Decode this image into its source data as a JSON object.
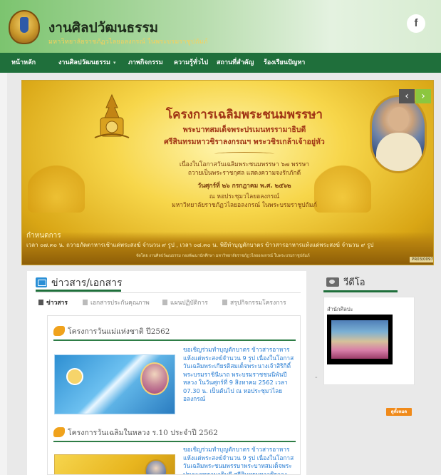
{
  "site": {
    "title": "งานศิลปวัฒนธรรม",
    "subtitle": "มหาวิทยาลัยราชภัฏวไลยอลงกรณ์ ในพระบรมราชูปถัมภ์",
    "social_icon": "facebook-icon",
    "social_glyph": "f"
  },
  "nav": {
    "items": [
      {
        "label": "หน้าหลัก"
      },
      {
        "label": "งานศิลปวัฒนธรรม",
        "caret": "▾"
      },
      {
        "label": "ภาพกิจกรรม"
      },
      {
        "label": "ความรู้ทั่วไป"
      },
      {
        "label": "สถานที่สำคัญ"
      },
      {
        "label": "ร้องเรียนปัญหา"
      }
    ]
  },
  "banner": {
    "title": "โครงการเฉลิมพระชนมพรรษา",
    "line1": "พระบาทสมเด็จพระปรเมนทรรามาธิบดี",
    "line2": "ศรีสินทรมหาวชิราลงกรณฯ พระวชิรเกล้าเจ้าอยู่หัว",
    "small1": "เนื่องในโอกาสวันเฉลิมพระชนมพรรษา ๖๗ พรรษา",
    "small2": "ถวายเป็นพระราชกุศล แสดงความจงรักภักดี",
    "small3": "วันศุกร์ที่ ๒๖ กรกฎาคม พ.ศ. ๒๕๖๒",
    "small4": "ณ หอประชุมวไลยอลงกรณ์",
    "small5": "มหาวิทยาลัยราชภัฏวไลยอลงกรณ์ ในพระบรมราชูปถัมภ์",
    "schedule_label": "กำหนดการ",
    "schedule_text": "เวลา ๐๗.๓๐ น. ถวายภัตตาหารเช้าแด่พระสงฆ์ จำนวน ๙ รูป    ,   เวลา ๐๘.๓๐ น. พิธีทำบุญตักบาตร ข้าวสารอาหารแห้งแด่พระสงฆ์ จำนวน ๙ รูป",
    "schedule_foot": "จัดโดย งานศิลปวัฒนธรรม กองพัฒนานักศึกษา มหาวิทยาลัยราชภัฏวไลยอลงกรณ์ ในพระบรมราชูปถัมภ์",
    "code": "PR03/0097",
    "prev_glyph": "‹",
    "next_glyph": "›",
    "colors": {
      "title": "#a03414",
      "gold": "#f7d64a",
      "next_button": "#8cc63f",
      "prev_button": "#555555"
    }
  },
  "news": {
    "heading": "ข่าวสาร/เอกสาร",
    "tabs": [
      {
        "label": "ข่าวสาร",
        "active": true
      },
      {
        "label": "เอกสารประกันคุณภาพ",
        "active": false
      },
      {
        "label": "แผนปฏิบัติการ",
        "active": false
      },
      {
        "label": "สรุปกิจกรรมโครงการ",
        "active": false
      }
    ],
    "articles": [
      {
        "title": "โครงการวันแม่แห่งชาติ ปี2562",
        "text": "ขอเชิญร่วมทำบุญตักบาตร ข้าวสารอาหารแห้งแด่พระสงฆ์จำนวน 9 รูป เนื่องในโอกาสวันเฉลิมพระเกียรติสมเด็จพระนางเจ้าสิริกิติ์ พระบรมราชินีนาถ พระบรมราชชนนีพันปีหลวง ในวันศุกร์ที่ 9 สิงหาคม 2562 เวลา 07.30 น. เป็นต้นไป ณ หอประชุมวไลยอลงกรณ์"
      },
      {
        "title": "โครงการวันเฉลิมในหลวง ร.10 ประจำปี 2562",
        "text": "ขอเชิญร่วมทำบุญตักบาตร ข้าวสารอาหารแห้งแด่พระสงฆ์จำนวน 9 รูป เนื่องในโอกาสวันเฉลิมพระชนมพรรษาพระบาทสมเด็จพระปรเมนทรรามาธิบดี ศรีสินทรมหาวชิราลงกรณ"
      }
    ]
  },
  "video": {
    "heading": "วีดีโอ",
    "label": "สำนักศิลปะ",
    "dash": "-",
    "badge": "ดูทั้งหมด"
  },
  "colors": {
    "nav_bg": "#1f6f3b",
    "accent_green": "#1f6f3b",
    "link_blue": "#2a7ed3",
    "badge_orange": "#f08a1a"
  }
}
